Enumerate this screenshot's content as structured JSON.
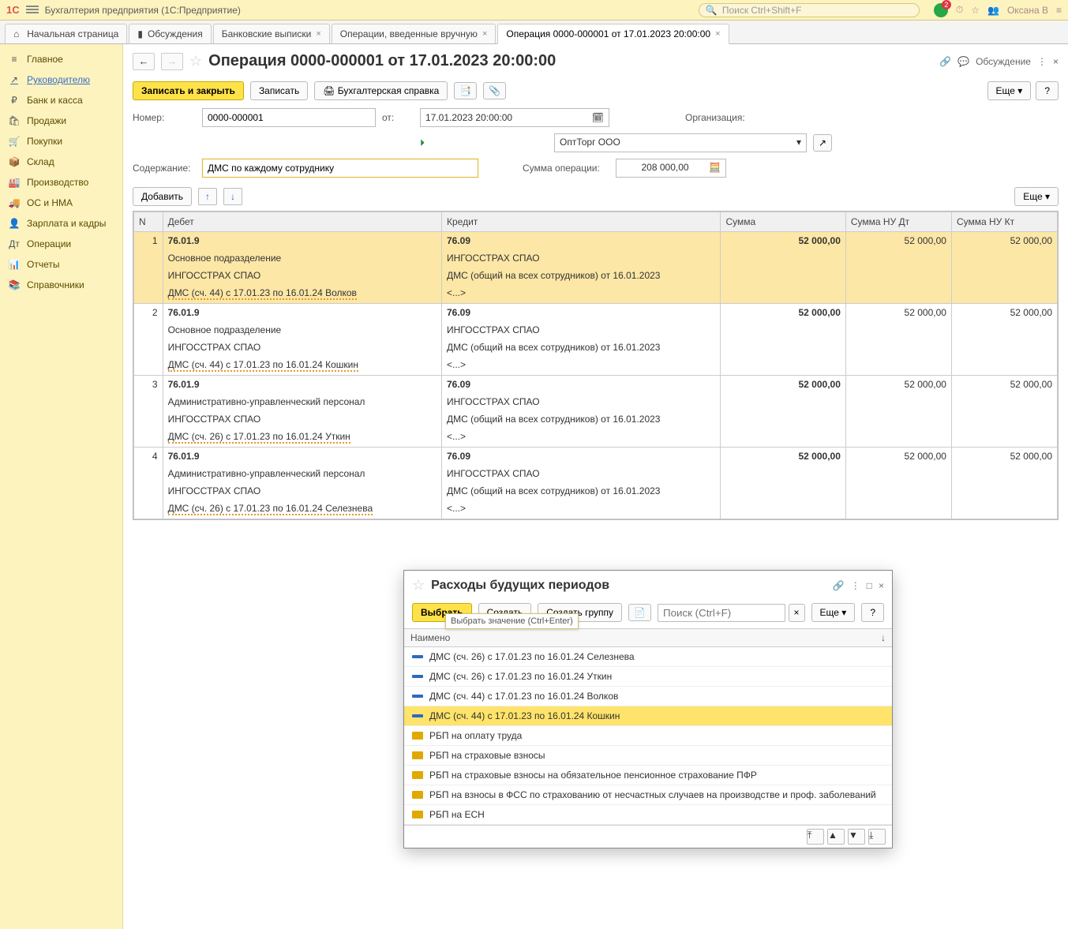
{
  "app": {
    "title": "Бухгалтерия предприятия  (1С:Предприятие)",
    "search_placeholder": "Поиск Ctrl+Shift+F",
    "user": "Оксана В",
    "bell_count": "2"
  },
  "tabs": {
    "items": [
      {
        "label": "Начальная страница"
      },
      {
        "label": "Обсуждения"
      },
      {
        "label": "Банковские выписки"
      },
      {
        "label": "Операции, введенные вручную"
      },
      {
        "label": "Операция 0000-000001 от 17.01.2023 20:00:00"
      }
    ]
  },
  "sidebar": {
    "items": [
      {
        "icon": "≡",
        "label": "Главное"
      },
      {
        "icon": "↗",
        "label": "Руководителю"
      },
      {
        "icon": "₽",
        "label": "Банк и касса"
      },
      {
        "icon": "🛍",
        "label": "Продажи"
      },
      {
        "icon": "🛒",
        "label": "Покупки"
      },
      {
        "icon": "📦",
        "label": "Склад"
      },
      {
        "icon": "🏭",
        "label": "Производство"
      },
      {
        "icon": "🚚",
        "label": "ОС и НМА"
      },
      {
        "icon": "👤",
        "label": "Зарплата и кадры"
      },
      {
        "icon": "Дт",
        "label": "Операции"
      },
      {
        "icon": "📊",
        "label": "Отчеты"
      },
      {
        "icon": "📚",
        "label": "Справочники"
      }
    ]
  },
  "page": {
    "title": "Операция 0000-000001 от 17.01.2023 20:00:00",
    "discuss": "Обсуждение",
    "write_close": "Записать и закрыть",
    "write": "Записать",
    "acc_ref": "Бухгалтерская справка",
    "more": "Еще",
    "help": "?",
    "number_label": "Номер:",
    "number": "0000-000001",
    "from_label": "от:",
    "date": "17.01.2023 20:00:00",
    "org_label": "Организация:",
    "org": "ОптТорг ООО",
    "desc_label": "Содержание:",
    "desc": "ДМС по каждому сотруднику",
    "sumop_label": "Сумма операции:",
    "sumop": "208 000,00",
    "add": "Добавить"
  },
  "grid": {
    "headers": {
      "n": "N",
      "debit": "Дебет",
      "credit": "Кредит",
      "sum": "Сумма",
      "nud": "Сумма НУ Дт",
      "nuk": "Сумма НУ Кт"
    },
    "rows": [
      {
        "n": "1",
        "d_acc": "76.01.9",
        "c_acc": "76.09",
        "sum": "52 000,00",
        "nud": "52 000,00",
        "nuk": "52 000,00",
        "d_l1": "Основное подразделение",
        "c_l1": "ИНГОССТРАХ СПАО",
        "d_l2": "ИНГОССТРАХ СПАО",
        "c_l2": "ДМС (общий на всех сотрудников) от 16.01.2023",
        "d_l3": "ДМС (сч. 44) с 17.01.23 по 16.01.24 Волков",
        "c_l3": "<...>"
      },
      {
        "n": "2",
        "d_acc": "76.01.9",
        "c_acc": "76.09",
        "sum": "52 000,00",
        "nud": "52 000,00",
        "nuk": "52 000,00",
        "d_l1": "Основное подразделение",
        "c_l1": "ИНГОССТРАХ СПАО",
        "d_l2": "ИНГОССТРАХ СПАО",
        "c_l2": "ДМС (общий на всех сотрудников) от 16.01.2023",
        "d_l3": "ДМС (сч. 44) с 17.01.23 по 16.01.24 Кошкин",
        "c_l3": "<...>"
      },
      {
        "n": "3",
        "d_acc": "76.01.9",
        "c_acc": "76.09",
        "sum": "52 000,00",
        "nud": "52 000,00",
        "nuk": "52 000,00",
        "d_l1": "Административно-управленческий персонал",
        "c_l1": "ИНГОССТРАХ СПАО",
        "d_l2": "ИНГОССТРАХ СПАО",
        "c_l2": "ДМС (общий на всех сотрудников) от 16.01.2023",
        "d_l3": "ДМС (сч. 26) с 17.01.23 по 16.01.24 Уткин",
        "c_l3": "<...>"
      },
      {
        "n": "4",
        "d_acc": "76.01.9",
        "c_acc": "76.09",
        "sum": "52 000,00",
        "nud": "52 000,00",
        "nuk": "52 000,00",
        "d_l1": "Административно-управленческий персонал",
        "c_l1": "ИНГОССТРАХ СПАО",
        "d_l2": "ИНГОССТРАХ СПАО",
        "c_l2": "ДМС (общий на всех сотрудников) от 16.01.2023",
        "d_l3": "ДМС (сч. 26) с 17.01.23 по 16.01.24 Селезнева",
        "c_l3": "<...>"
      }
    ]
  },
  "dialog": {
    "title": "Расходы будущих периодов",
    "select": "Выбрать",
    "create": "Создать",
    "create_grp": "Создать группу",
    "more": "Еще",
    "help": "?",
    "search_placeholder": "Поиск (Ctrl+F)",
    "name_header": "Наимено",
    "tooltip": "Выбрать значение (Ctrl+Enter)",
    "items": [
      {
        "label": "ДМС (сч. 26) с 17.01.23 по 16.01.24 Селезнева"
      },
      {
        "label": "ДМС (сч. 26) с 17.01.23 по 16.01.24 Уткин"
      },
      {
        "label": "ДМС (сч. 44) с 17.01.23 по 16.01.24 Волков"
      },
      {
        "label": "ДМС (сч. 44) с 17.01.23 по 16.01.24 Кошкин"
      },
      {
        "label": "РБП на оплату труда"
      },
      {
        "label": "РБП на страховые взносы"
      },
      {
        "label": "РБП на страховые взносы на обязательное пенсионное страхование ПФР"
      },
      {
        "label": "РБП на взносы в ФСС по страхованию от несчастных случаев на производстве и проф. заболеваний"
      },
      {
        "label": "РБП на ЕСН"
      }
    ],
    "selected_index": 3
  }
}
